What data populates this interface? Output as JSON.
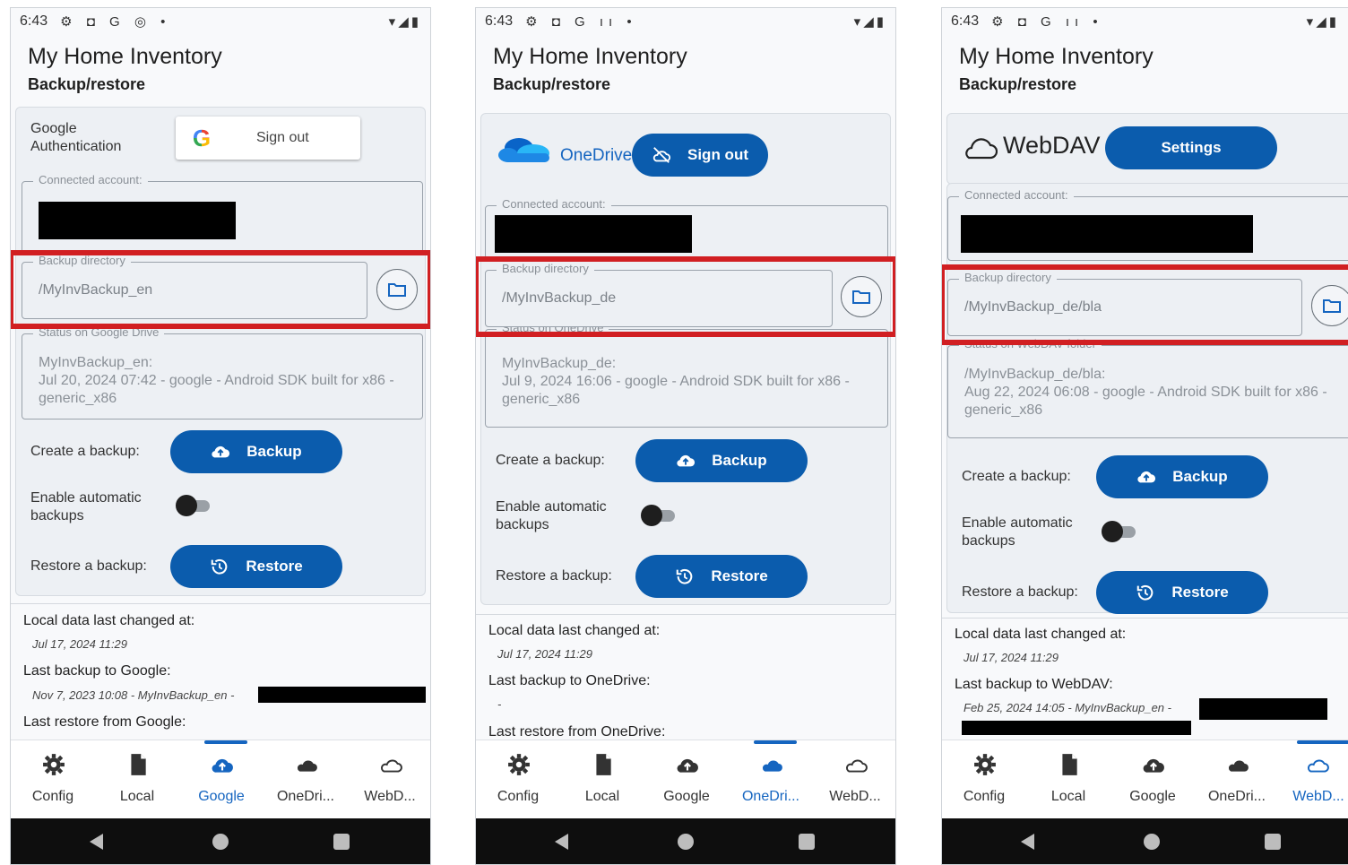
{
  "colors": {
    "accent": "#0b5cad",
    "nav_active": "#1565c0",
    "highlight": "#d11f22"
  },
  "phones": [
    {
      "status_bar": {
        "time": "6:43",
        "icons": "⚙ ◘ G ◎ •",
        "right": "▾◢▮"
      },
      "app_title": "My Home Inventory",
      "subtitle": "Backup/restore",
      "provider": {
        "name": "Google\nAuthentication",
        "button": "Sign out"
      },
      "connected_account_legend": "Connected account:",
      "backup_directory": {
        "legend": "Backup directory",
        "value": "/MyInvBackup_en"
      },
      "status_legend": "Status on Google Drive",
      "status_text": "MyInvBackup_en:\nJul 20, 2024 07:42 - google - Android SDK built for x86 - generic_x86",
      "create_backup_label": "Create a backup:",
      "backup_button": "Backup",
      "auto_backup_label": "Enable automatic backups",
      "restore_label": "Restore a backup:",
      "restore_button": "Restore",
      "local_changed_label": "Local data last changed at:",
      "local_changed_value": "Jul 17, 2024 11:29",
      "last_backup_label": "Last backup to Google:",
      "last_backup_value": "Nov 7, 2023 10:08 - MyInvBackup_en -",
      "last_restore_label": "Last restore from Google:",
      "nav": [
        "Config",
        "Local",
        "Google",
        "OneDri...",
        "WebD..."
      ],
      "active_nav": 2
    },
    {
      "status_bar": {
        "time": "6:43",
        "icons": "⚙ ◘ G ıı •",
        "right": "▾◢▮"
      },
      "app_title": "My Home Inventory",
      "subtitle": "Backup/restore",
      "provider": {
        "name": "OneDrive",
        "button": "Sign out"
      },
      "connected_account_legend": "Connected account:",
      "backup_directory": {
        "legend": "Backup directory",
        "value": "/MyInvBackup_de"
      },
      "status_legend": "Status on OneDrive",
      "status_text": "MyInvBackup_de:\nJul 9, 2024 16:06 - google - Android SDK built for x86 - generic_x86",
      "create_backup_label": "Create a backup:",
      "backup_button": "Backup",
      "auto_backup_label": "Enable automatic backups",
      "restore_label": "Restore a backup:",
      "restore_button": "Restore",
      "local_changed_label": "Local data last changed at:",
      "local_changed_value": "Jul 17, 2024 11:29",
      "last_backup_label": "Last backup to OneDrive:",
      "last_backup_value": "-",
      "last_restore_label": "Last restore from OneDrive:",
      "nav": [
        "Config",
        "Local",
        "Google",
        "OneDri...",
        "WebD..."
      ],
      "active_nav": 3
    },
    {
      "status_bar": {
        "time": "6:43",
        "icons": "⚙ ◘ G ıı •",
        "right": "▾◢▮"
      },
      "app_title": "My Home Inventory",
      "subtitle": "Backup/restore",
      "provider": {
        "name": "WebDAV",
        "button": "Settings"
      },
      "connected_account_legend": "Connected account:",
      "backup_directory": {
        "legend": "Backup directory",
        "value": "/MyInvBackup_de/bla"
      },
      "status_legend": "Status on WebDAV folder",
      "status_text": "/MyInvBackup_de/bla:\nAug 22, 2024 06:08 - google - Android SDK built for x86 - generic_x86",
      "create_backup_label": "Create a backup:",
      "backup_button": "Backup",
      "auto_backup_label": "Enable automatic backups",
      "restore_label": "Restore a backup:",
      "restore_button": "Restore",
      "local_changed_label": "Local data last changed at:",
      "local_changed_value": "Jul 17, 2024 11:29",
      "last_backup_label": "Last backup to WebDAV:",
      "last_backup_value": "Feb 25, 2024 14:05 - MyInvBackup_en -",
      "last_restore_label": "",
      "nav": [
        "Config",
        "Local",
        "Google",
        "OneDri...",
        "WebD..."
      ],
      "active_nav": 4
    }
  ]
}
